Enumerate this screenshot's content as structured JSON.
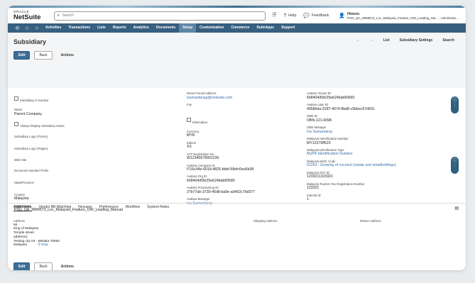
{
  "app": {
    "logo_top": "ORACLE",
    "logo_name": "NetSuite"
  },
  "search": {
    "placeholder": "Search"
  },
  "topbar": {
    "help_label": "Help",
    "feedback_label": "Feedback",
    "user_name": "Himon",
    "user_context": "PSG_QA_9899573_Loc_Malaysia_Feature_OW_Leading_Ma... - Administra..."
  },
  "nav": {
    "items": [
      "Activities",
      "Transactions",
      "Lists",
      "Reports",
      "Analytics",
      "Documents",
      "Setup",
      "Customization",
      "Commerce",
      "SuiteApps",
      "Support"
    ],
    "active": "Setup"
  },
  "page": {
    "title": "Subsidiary",
    "list": "List",
    "settings": "Subsidiary Settings",
    "search": "Search",
    "prev": "←",
    "next": "→"
  },
  "buttons": {
    "edit": "Edit",
    "back": "Back",
    "actions": "Actions"
  },
  "left": {
    "inactive": "Subsidiary is Inactive",
    "name_label": "Name",
    "name_value": "Parent Company",
    "always_display": "Always Display Subsidiary Name",
    "logo_forms": "Subsidiary Logo (Forms)",
    "logo_pages": "Subsidiary Logo (Pages)",
    "website": "Web Site",
    "doc_prefix": "Document Number Prefix",
    "state": "State/Province",
    "country_label": "Country",
    "country_value": "Malaysia",
    "legal_label": "Legal Name",
    "legal_value": "PSG_QA_9899573_Loc_Malaysia_Feature_OW_Leading_Manual"
  },
  "mid": {
    "return_email_label": "Return Email Address",
    "return_email_value": "lsamantarayj@netsuite.com",
    "fax": "Fax",
    "elimination": "Elimination",
    "currency_label": "Currency",
    "currency_value": "MYR",
    "edition_label": "Edition",
    "edition_value": "XX",
    "vat_label": "VAT Registration No.",
    "vat_value": "W12345678901239",
    "company_id_label": "Avalara Company ID",
    "company_id_value": "f716c04e-601d-4825-bbbf-58efc0ea5b38",
    "org_id_label": "Avalara Org ID",
    "org_id_value": "668404d5fe25eb24bab60580",
    "prov_id_label": "Avalara Provisioning ID",
    "prov_id_value": "27b77ab-3730-45d8-ba9e-a0462c7bd377",
    "manager_label": "Avalara Manager",
    "manager_value": "Iva Samantaray"
  },
  "right": {
    "tenant_label": "Avalara Tenant ID",
    "tenant_value": "668404d5fe25eb24bab60581",
    "user_label": "Avalara User ID",
    "user_value": "49586da-3187-4674-8bd8-c5bbec57d691",
    "obn_label": "OBN ID",
    "obn_value": "OBN-121-0098",
    "obn_mgr_label": "OBN Manager",
    "obn_mgr_value": "Iva Samantaray",
    "mid_label": "Malaysia Identification Number",
    "mid_value": "MY12376ff523",
    "mid_type_label": "Malaysia Identification Type",
    "mid_type_value": "MyPR Identification Number",
    "msic_label": "Malaysia MSIC Code",
    "msic_value": "01263 - Growing of coconut (estate and smallholdings)",
    "sst_label": "Malaysia SST ID",
    "sst_value": "1233211323321",
    "tourism_label": "Malaysia Tourism Tax Registration Number",
    "tourism_value": "123321",
    "internal_label": "Internal ID",
    "internal_value": "1"
  },
  "tabs": [
    "Addresses",
    "Vendor Bill Matching",
    "Nexuses",
    "Preferences",
    "Workflow",
    "System Notes"
  ],
  "address": {
    "addr_label": "Address",
    "shipping_label": "Shipping Address",
    "return_label": "Return Address",
    "lines": [
      "Mr.",
      "King of Malaysia",
      "Temple street",
      "address2",
      "Testing city 04 - Melaka 79050",
      "Malaysia"
    ],
    "map": "Map"
  }
}
